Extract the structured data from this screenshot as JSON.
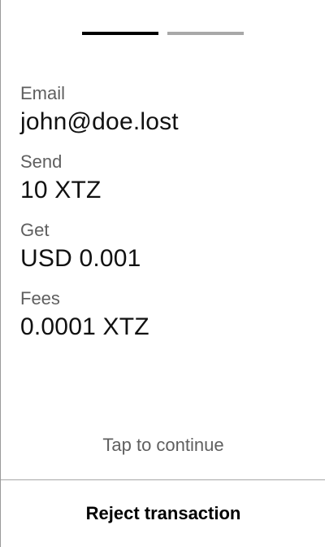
{
  "progress": {
    "steps_total": 2,
    "current_step": 1,
    "active_color": "#000000",
    "inactive_color": "#a8a8a8"
  },
  "fields": [
    {
      "label": "Email",
      "value": "john@doe.lost"
    },
    {
      "label": "Send",
      "value": "10 XTZ"
    },
    {
      "label": "Get",
      "value": "USD 0.001"
    },
    {
      "label": "Fees",
      "value": "0.0001 XTZ"
    }
  ],
  "tap_hint": "Tap to continue",
  "reject_button": {
    "label": "Reject transaction"
  }
}
